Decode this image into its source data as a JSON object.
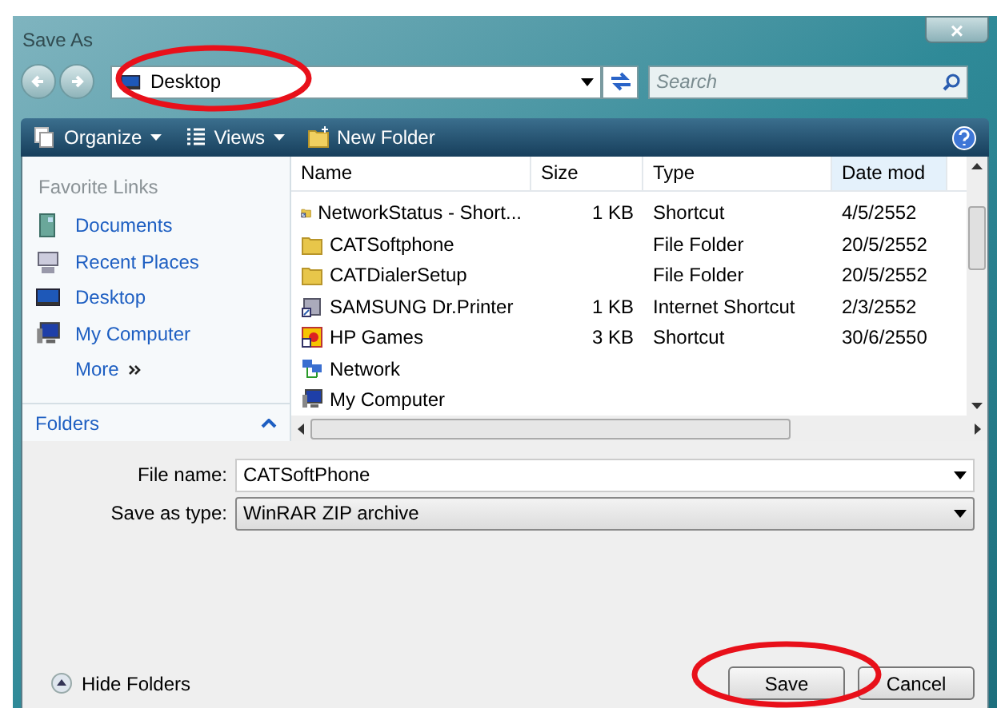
{
  "window": {
    "title": "Save As",
    "close": "×"
  },
  "address_bar": {
    "value": "Desktop",
    "circled": true
  },
  "search": {
    "placeholder": "Search"
  },
  "toolbar": [
    "Organize",
    "Views",
    "New Folder"
  ],
  "sidebar": {
    "heading": "Favorite Links",
    "items": [
      {
        "label": "Documents",
        "kind": "documents"
      },
      {
        "label": "Recent Places",
        "kind": "recent"
      },
      {
        "label": "Desktop",
        "kind": "desktop"
      },
      {
        "label": "My Computer",
        "kind": "computer"
      }
    ],
    "more": "More",
    "folders": "Folders"
  },
  "table": {
    "columns": [
      "Name",
      "Size",
      "Type",
      "Date mod"
    ],
    "rows": [
      {
        "kind": "shortcut",
        "cells": [
          "NetworkStatus - Short...",
          "1 KB",
          "Shortcut",
          "4/5/2552"
        ]
      },
      {
        "kind": "folder",
        "cells": [
          "CATSoftphone",
          "",
          "File Folder",
          "20/5/2552"
        ]
      },
      {
        "kind": "folder",
        "cells": [
          "CATDialerSetup",
          "",
          "File Folder",
          "20/5/2552"
        ]
      },
      {
        "kind": "printer",
        "cells": [
          "SAMSUNG Dr.Printer",
          "1 KB",
          "Internet Shortcut",
          "2/3/2552"
        ]
      },
      {
        "kind": "games",
        "cells": [
          "HP Games",
          "3 KB",
          "Shortcut",
          "30/6/2550"
        ]
      },
      {
        "kind": "network",
        "cells": [
          "Network",
          "",
          "",
          ""
        ]
      },
      {
        "kind": "computer",
        "cells": [
          "My Computer",
          "",
          "",
          ""
        ]
      }
    ]
  },
  "file_name": {
    "label": "File name:",
    "value": "CATSoftPhone"
  },
  "save_as_type": {
    "label": "Save as type:",
    "value": "WinRAR ZIP archive"
  },
  "hide_folders": "Hide Folders",
  "buttons": [
    {
      "label": "Save",
      "circled": true
    },
    {
      "label": "Cancel",
      "circled": false
    }
  ]
}
